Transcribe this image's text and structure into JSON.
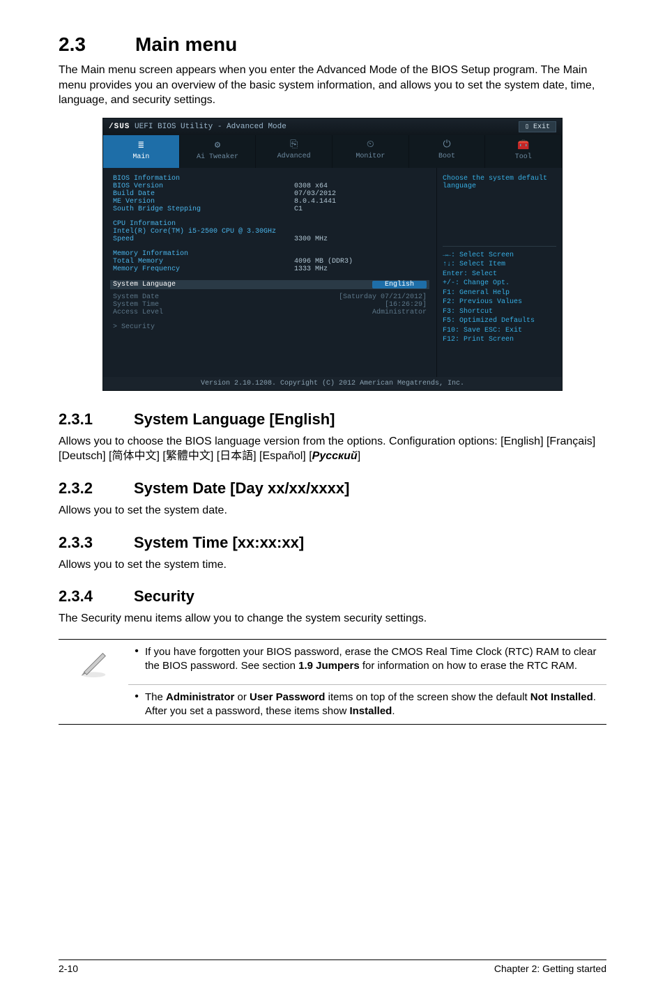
{
  "header": {
    "num": "2.3",
    "title": "Main menu",
    "intro": "The Main menu screen appears when you enter the Advanced Mode of the BIOS Setup program. The Main menu provides you an overview of the basic system information, and allows you to set the system date, time, language, and security settings."
  },
  "bios": {
    "titlebar_brand_logo": "/SUS",
    "titlebar_text": "UEFI BIOS Utility - Advanced Mode",
    "exit_label": "Exit",
    "tabs": [
      {
        "label": "Main",
        "icon": "≣"
      },
      {
        "label": "Ai Tweaker",
        "icon": "⚙"
      },
      {
        "label": "Advanced",
        "icon": "⎘"
      },
      {
        "label": "Monitor",
        "icon": "⏲"
      },
      {
        "label": "Boot",
        "icon": "⏻"
      },
      {
        "label": "Tool",
        "icon": "🧰"
      }
    ],
    "left": {
      "bios_info_header": "BIOS Information",
      "rows1": [
        {
          "label": "BIOS Version",
          "value": "0308 x64"
        },
        {
          "label": "Build Date",
          "value": "07/03/2012"
        },
        {
          "label": "ME Version",
          "value": "8.0.4.1441"
        },
        {
          "label": "South Bridge Stepping",
          "value": "C1"
        }
      ],
      "cpu_info_header": "CPU Information",
      "cpu_model": "Intel(R) Core(TM) i5-2500 CPU @ 3.30GHz",
      "cpu_speed_label": "Speed",
      "cpu_speed_value": "3300 MHz",
      "mem_info_header": "Memory Information",
      "mem_rows": [
        {
          "label": "Total Memory",
          "value": "4096 MB (DDR3)"
        },
        {
          "label": "Memory Frequency",
          "value": "1333 MHz"
        }
      ],
      "sys_lang_label": "System Language",
      "sys_lang_value": "English",
      "dim_rows": [
        {
          "label": "System Date",
          "value": "[Saturday 07/21/2012]"
        },
        {
          "label": "System Time",
          "value": "[16:26:29]"
        },
        {
          "label": "Access Level",
          "value": "Administrator"
        }
      ],
      "security_label": "> Security"
    },
    "right": {
      "hint": "Choose the system default language",
      "help": [
        "→←: Select Screen",
        "↑↓: Select Item",
        "Enter: Select",
        "+/-: Change Opt.",
        "F1: General Help",
        "F2: Previous Values",
        "F3: Shortcut",
        "F5: Optimized Defaults",
        "F10: Save  ESC: Exit",
        "F12: Print Screen"
      ]
    },
    "footer": "Version 2.10.1208. Copyright (C) 2012 American Megatrends, Inc."
  },
  "sections": {
    "s231": {
      "num": "2.3.1",
      "title": "System Language [English]",
      "p1": "Allows you to choose the BIOS language version from the options. Configuration options: [English] [Français] [Deutsch] [简体中文] [繁體中文] [日本語] [Español] [",
      "rus": "Русский",
      "p1_end": "]"
    },
    "s232": {
      "num": "2.3.2",
      "title": "System Date [Day xx/xx/xxxx]",
      "p": "Allows you to set the system date."
    },
    "s233": {
      "num": "2.3.3",
      "title": "System Time [xx:xx:xx]",
      "p": "Allows you to set the system time."
    },
    "s234": {
      "num": "2.3.4",
      "title": "Security",
      "p": "The Security menu items allow you to change the system security settings."
    }
  },
  "notes": {
    "n1_a": "If you have forgotten your BIOS password, erase the CMOS Real Time Clock (RTC) RAM to clear the BIOS password. See section ",
    "n1_bold": "1.9 Jumpers",
    "n1_b": " for information on how to erase the RTC RAM.",
    "n2_a": "The ",
    "n2_bold1": "Administrator",
    "n2_mid1": " or ",
    "n2_bold2": "User Password",
    "n2_mid2": " items on top of the screen show the default ",
    "n2_bold3": "Not Installed",
    "n2_mid3": ". After you set a password, these items show ",
    "n2_bold4": "Installed",
    "n2_end": "."
  },
  "footer": {
    "left": "2-10",
    "right": "Chapter 2: Getting started"
  }
}
